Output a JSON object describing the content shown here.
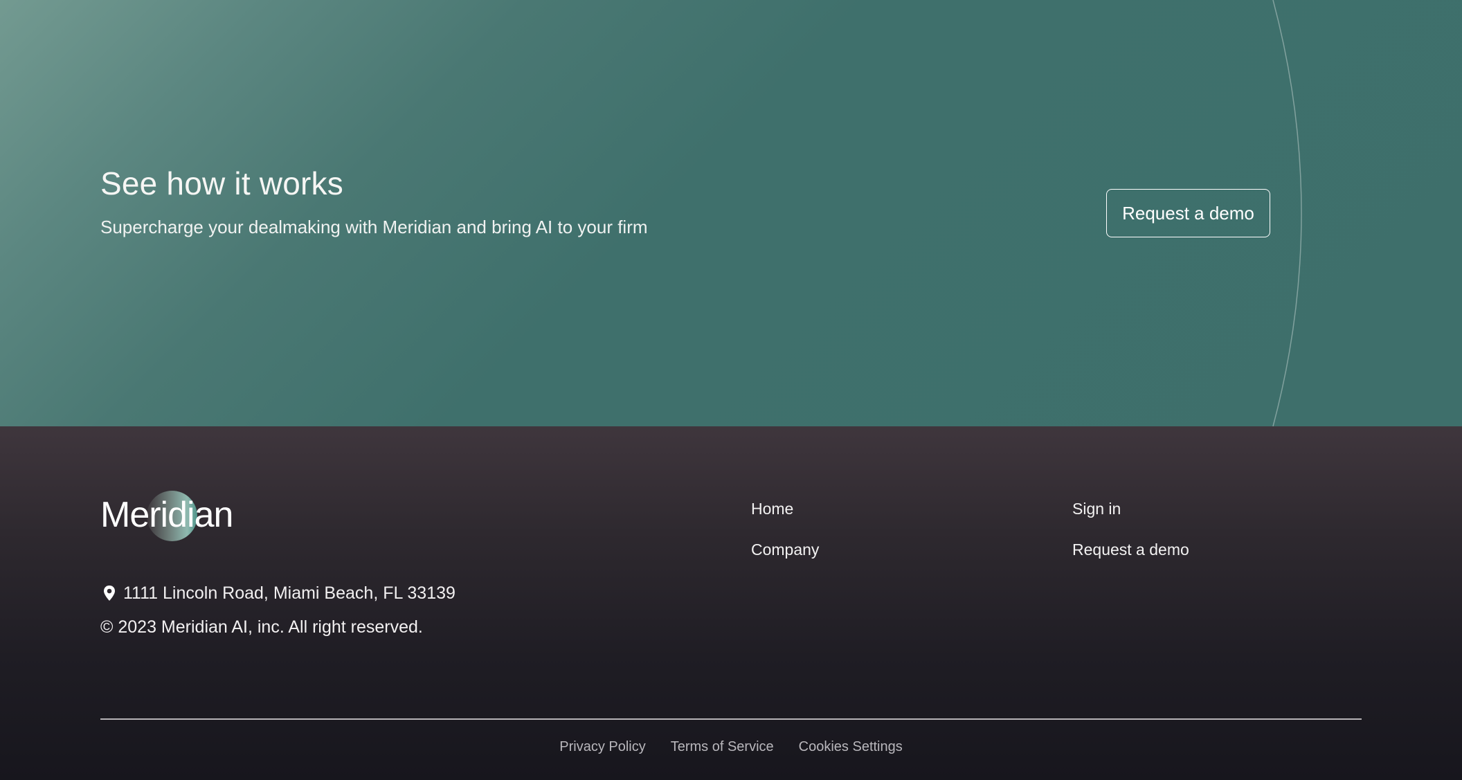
{
  "cta": {
    "title": "See how it works",
    "subtitle": "Supercharge your dealmaking with Meridian and bring AI to your firm",
    "button_label": "Request a demo"
  },
  "footer": {
    "logo_text": "Meridian",
    "address": "1111 Lincoln Road, Miami Beach, FL 33139",
    "copyright": "© 2023 Meridian AI, inc. All right reserved.",
    "nav_col1": [
      "Home",
      "Company"
    ],
    "nav_col2": [
      "Sign in",
      "Request a demo"
    ],
    "legal_links": [
      "Privacy Policy",
      "Terms of Service",
      "Cookies Settings"
    ]
  },
  "icons": {
    "address": "location-pin-icon"
  },
  "colors": {
    "cta_bg": "#3e6f6b",
    "footer_bg": "#1a1920",
    "text": "#ffffff"
  }
}
